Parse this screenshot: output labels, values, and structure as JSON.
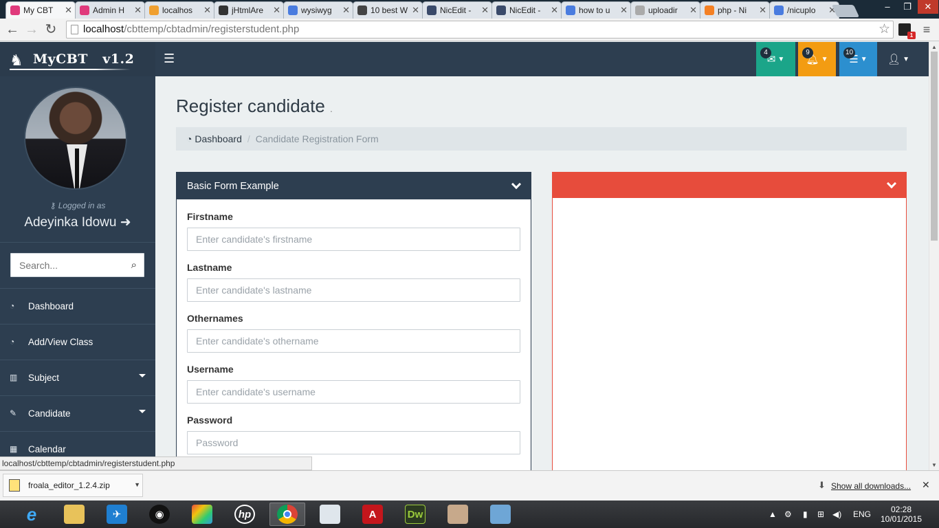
{
  "browser": {
    "tabs": [
      {
        "label": "My CBT",
        "favicon": "site-favicon",
        "color": "#e03a7c",
        "active": true
      },
      {
        "label": "Admin H",
        "favicon": "site-favicon",
        "color": "#e03a7c"
      },
      {
        "label": "localhos",
        "favicon": "phpmyadmin-favicon",
        "color": "#f0a030"
      },
      {
        "label": "jHtmlAre",
        "favicon": "github-favicon",
        "color": "#333333"
      },
      {
        "label": "wysiwyg",
        "favicon": "google-favicon",
        "color": "#4a7cdf"
      },
      {
        "label": "10 best W",
        "favicon": "tutorial-favicon",
        "color": "#444444"
      },
      {
        "label": "NicEdit -",
        "favicon": "globe-favicon",
        "color": "#3a4a6a"
      },
      {
        "label": "NicEdit -",
        "favicon": "globe-favicon",
        "color": "#3a4a6a"
      },
      {
        "label": "how to u",
        "favicon": "google-favicon",
        "color": "#4a7cdf"
      },
      {
        "label": "uploadir",
        "favicon": "page-favicon",
        "color": "#aaaaaa"
      },
      {
        "label": "php - Ni",
        "favicon": "stackoverflow-favicon",
        "color": "#f48024"
      },
      {
        "label": "/nicuplo",
        "favicon": "google-favicon",
        "color": "#4a7cdf"
      }
    ],
    "url_host": "localhost",
    "url_path": "/cbttemp/cbtadmin/registerstudent.php",
    "status_url": "localhost/cbttemp/cbtadmin/registerstudent.php",
    "extension_badge": "1"
  },
  "header": {
    "logo_text": "MyCBT   v1.2",
    "messages_count": "4",
    "notifications_count": "9",
    "tasks_count": "10",
    "colors": {
      "messages": "#1ba589",
      "notifications": "#f39c12",
      "tasks": "#2c8fcf"
    }
  },
  "sidebar": {
    "logged_label": "Logged in as",
    "user_name": "Adeyinka Idowu",
    "search_placeholder": "Search...",
    "items": [
      {
        "label": "Dashboard",
        "icon": "dashboard-icon",
        "has_caret": false
      },
      {
        "label": "Add/View Class",
        "icon": "dashboard-icon",
        "has_caret": false
      },
      {
        "label": "Subject",
        "icon": "bar-chart-icon",
        "has_caret": true
      },
      {
        "label": "Candidate",
        "icon": "edit-icon",
        "has_caret": true
      },
      {
        "label": "Calendar",
        "icon": "calendar-icon",
        "has_caret": false
      }
    ]
  },
  "main": {
    "title": "Register candidate",
    "title_suffix": ".",
    "breadcrumb": {
      "home": "Dashboard",
      "current": "Candidate Registration Form"
    },
    "form_panel": {
      "title": "Basic Form Example",
      "fields": [
        {
          "label": "Firstname",
          "placeholder": "Enter candidate's firstname",
          "value": ""
        },
        {
          "label": "Lastname",
          "placeholder": "Enter candidate's lastname",
          "value": ""
        },
        {
          "label": "Othernames",
          "placeholder": "Enter candidate's othername",
          "value": ""
        },
        {
          "label": "Username",
          "placeholder": "Enter candidate's username",
          "value": ""
        },
        {
          "label": "Password",
          "placeholder": "Password",
          "value": ""
        }
      ]
    },
    "right_panel": {
      "title": "",
      "color": "#e74c3c"
    }
  },
  "downloads": {
    "file_name": "froala_editor_1.2.4.zip",
    "show_all": "Show all downloads..."
  },
  "taskbar": {
    "language": "ENG",
    "time": "02:28",
    "date": "10/01/2015"
  }
}
